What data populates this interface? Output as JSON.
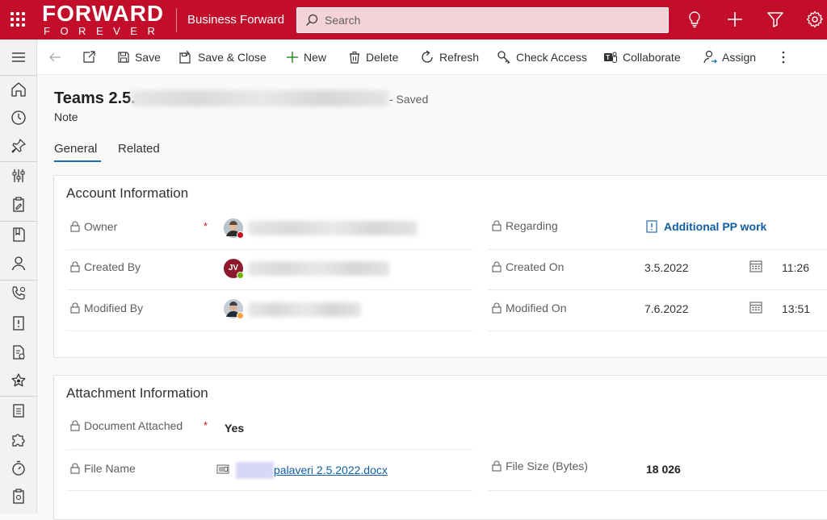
{
  "topbar": {
    "logo_line1": "FORWARD",
    "logo_line2": "FOREVER",
    "app_name": "Business Forward",
    "search_placeholder": "Search",
    "bg_color": "#c20d2b"
  },
  "commands": {
    "save": "Save",
    "save_close": "Save & Close",
    "new": "New",
    "delete": "Delete",
    "refresh": "Refresh",
    "check_access": "Check Access",
    "collaborate": "Collaborate",
    "assign": "Assign"
  },
  "record": {
    "title_prefix": "Teams 2.5.",
    "saved_status": "- Saved",
    "entity": "Note"
  },
  "tabs": [
    {
      "label": "General",
      "active": true
    },
    {
      "label": "Related",
      "active": false
    }
  ],
  "account_info": {
    "title": "Account Information",
    "owner_label": "Owner",
    "created_by_label": "Created By",
    "created_by_initials": "JV",
    "modified_by_label": "Modified By",
    "regarding_label": "Regarding",
    "regarding_value": "Additional PP work",
    "created_on_label": "Created On",
    "created_on_date": "3.5.2022",
    "created_on_time": "11:26",
    "modified_on_label": "Modified On",
    "modified_on_date": "7.6.2022",
    "modified_on_time": "13:51"
  },
  "attachment_info": {
    "title": "Attachment Information",
    "doc_attached_label": "Document Attached",
    "doc_attached_value": "Yes",
    "file_name_label": "File Name",
    "file_name_value": "palaveri 2.5.2022.docx",
    "file_size_label": "File Size (Bytes)",
    "file_size_value": "18 026"
  },
  "colors": {
    "brand": "#c20d2b",
    "link": "#115ea3",
    "required": "#c50f1f"
  }
}
